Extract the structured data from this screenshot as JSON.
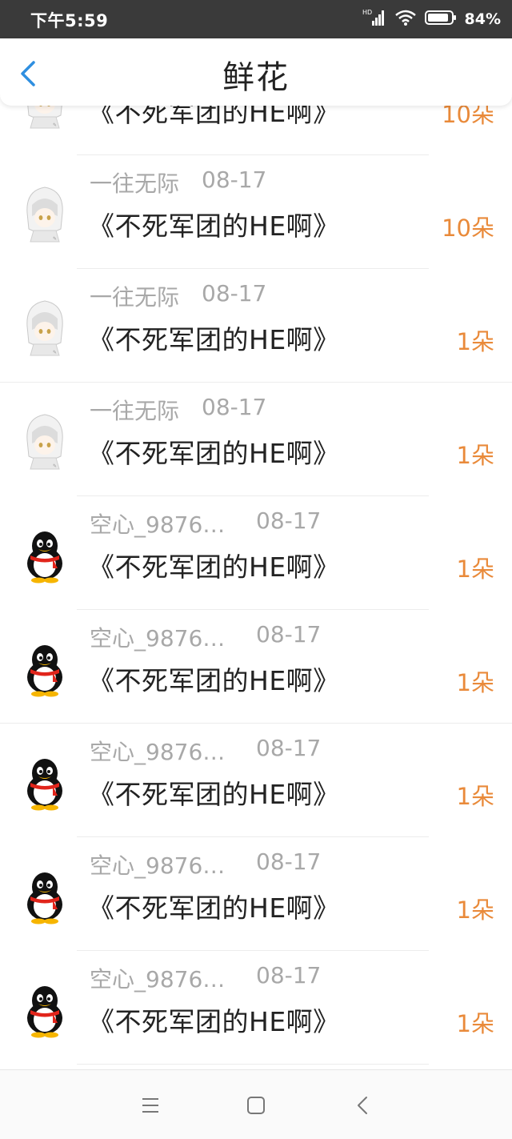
{
  "status_bar": {
    "time": "下午5:59",
    "battery": "84%"
  },
  "header": {
    "title": "鲜花",
    "back_icon": "chevron-left-icon"
  },
  "colors": {
    "accent": "#2f8fe0",
    "count": "#e98a3a",
    "meta": "#a8a8a8"
  },
  "items": [
    {
      "user": "",
      "date": "",
      "book": "《不死军团的HE啊》",
      "count": "10朵",
      "avatar": "anime-avatar"
    },
    {
      "user": "一往无际",
      "date": "08-17",
      "book": "《不死军团的HE啊》",
      "count": "10朵",
      "avatar": "anime-avatar"
    },
    {
      "user": "一往无际",
      "date": "08-17",
      "book": "《不死军团的HE啊》",
      "count": "1朵",
      "avatar": "anime-avatar"
    },
    {
      "user": "一往无际",
      "date": "08-17",
      "book": "《不死军团的HE啊》",
      "count": "1朵",
      "avatar": "anime-avatar"
    },
    {
      "user": "空心_9876…",
      "date": "08-17",
      "book": "《不死军团的HE啊》",
      "count": "1朵",
      "avatar": "penguin-avatar"
    },
    {
      "user": "空心_9876…",
      "date": "08-17",
      "book": "《不死军团的HE啊》",
      "count": "1朵",
      "avatar": "penguin-avatar"
    },
    {
      "user": "空心_9876…",
      "date": "08-17",
      "book": "《不死军团的HE啊》",
      "count": "1朵",
      "avatar": "penguin-avatar"
    },
    {
      "user": "空心_9876…",
      "date": "08-17",
      "book": "《不死军团的HE啊》",
      "count": "1朵",
      "avatar": "penguin-avatar"
    },
    {
      "user": "空心_9876…",
      "date": "08-17",
      "book": "《不死军团的HE啊》",
      "count": "1朵",
      "avatar": "penguin-avatar"
    }
  ],
  "nav_bar": {
    "menu_icon": "menu-icon",
    "home_icon": "home-square-icon",
    "back_icon": "back-triangle-icon"
  }
}
